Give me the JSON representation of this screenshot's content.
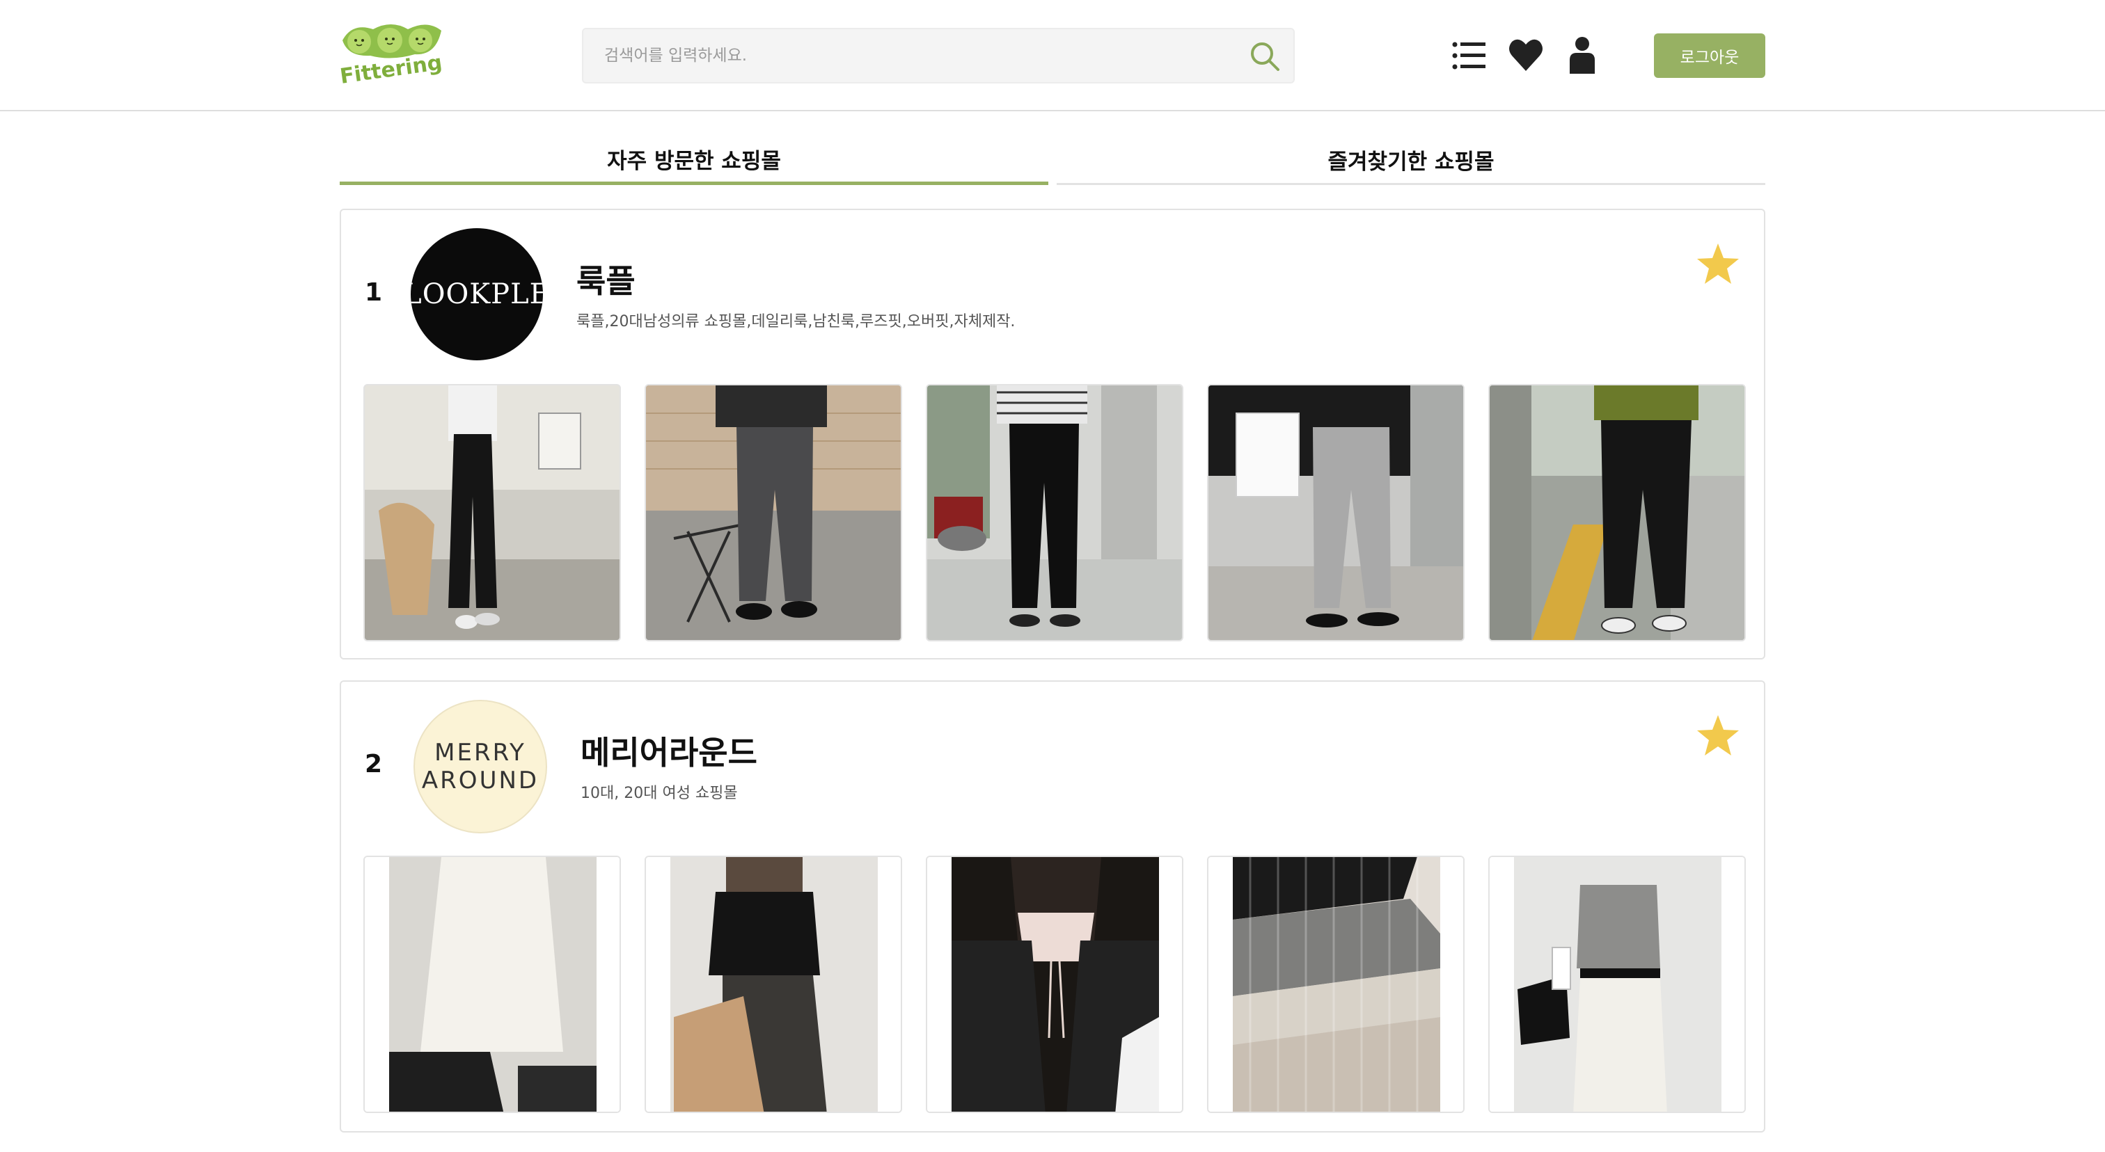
{
  "header": {
    "logo_text": "Fittering",
    "search_placeholder": "검색어를 입력하세요.",
    "logout_label": "로그아웃"
  },
  "tabs": [
    {
      "label": "자주 방문한 쇼핑몰",
      "active": true
    },
    {
      "label": "즐겨찾기한 쇼핑몰",
      "active": false
    }
  ],
  "shops": [
    {
      "rank": "1",
      "name": "룩플",
      "description": "룩플,20대남성의류 쇼핑몰,데일리룩,남친룩,루즈핏,오버핏,자체제작.",
      "logo_text": "LOOKPLE",
      "favorited": true
    },
    {
      "rank": "2",
      "name": "메리어라운드",
      "description": "10대, 20대 여성 쇼핑몰",
      "logo_line1": "MERRY",
      "logo_line2": "AROUND",
      "favorited": true
    }
  ],
  "colors": {
    "accent": "#97b163",
    "star": "#f2c94c",
    "tab_inactive_line": "#e3e3e3"
  }
}
